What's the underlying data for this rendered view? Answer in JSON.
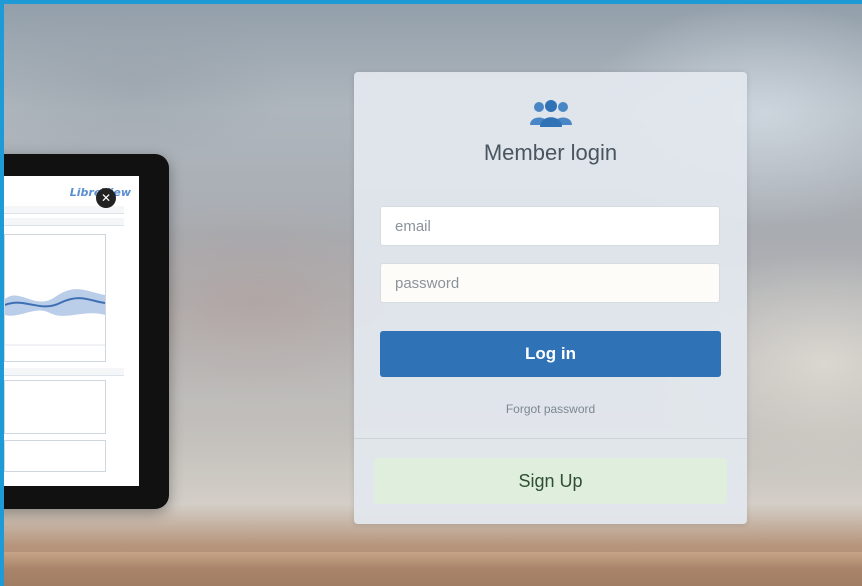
{
  "login": {
    "icon": "users-group-icon",
    "title": "Member login",
    "email_placeholder": "email",
    "password_placeholder": "password",
    "login_label": "Log in",
    "forgot_label": "Forgot password",
    "signup_label": "Sign Up"
  },
  "tablet": {
    "brand": "LibreView",
    "close_icon": "close-icon"
  },
  "colors": {
    "frame_border": "#1e9ad6",
    "login_button": "#2f72b6",
    "signup_button": "#dfeedd",
    "card_background": "#e2e8ee"
  }
}
